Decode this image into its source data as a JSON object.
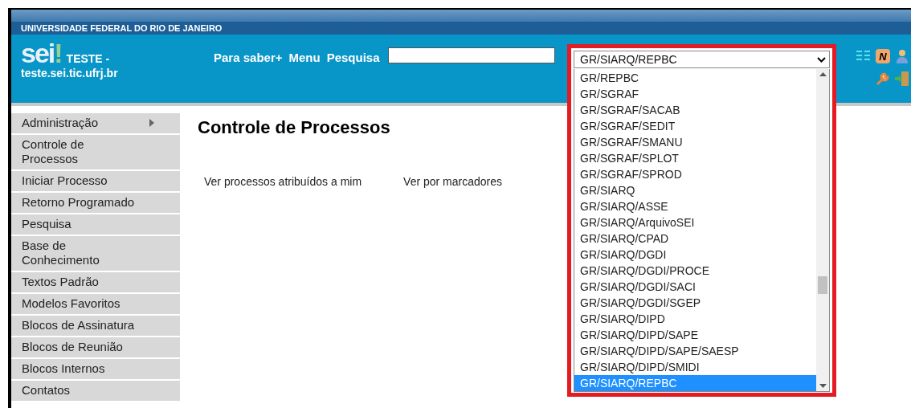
{
  "banner": {
    "title": "UNIVERSIDADE FEDERAL DO RIO DE JANEIRO"
  },
  "header": {
    "logo": "sei",
    "logo_mark": "!",
    "env": "TESTE -",
    "host": "teste.sei.tic.ufrj.br",
    "nav": [
      "Para saber+",
      "Menu",
      "Pesquisa"
    ],
    "badge": "N"
  },
  "unit_select": {
    "value": "GR/SIARQ/REPBC",
    "options": [
      {
        "label": "GR/REPBC",
        "selected": false
      },
      {
        "label": "GR/SGRAF",
        "selected": false
      },
      {
        "label": "GR/SGRAF/SACAB",
        "selected": false
      },
      {
        "label": "GR/SGRAF/SEDIT",
        "selected": false
      },
      {
        "label": "GR/SGRAF/SMANU",
        "selected": false
      },
      {
        "label": "GR/SGRAF/SPLOT",
        "selected": false
      },
      {
        "label": "GR/SGRAF/SPROD",
        "selected": false
      },
      {
        "label": "GR/SIARQ",
        "selected": false
      },
      {
        "label": "GR/SIARQ/ASSE",
        "selected": false
      },
      {
        "label": "GR/SIARQ/ArquivoSEI",
        "selected": false
      },
      {
        "label": "GR/SIARQ/CPAD",
        "selected": false
      },
      {
        "label": "GR/SIARQ/DGDI",
        "selected": false
      },
      {
        "label": "GR/SIARQ/DGDI/PROCE",
        "selected": false
      },
      {
        "label": "GR/SIARQ/DGDI/SACI",
        "selected": false
      },
      {
        "label": "GR/SIARQ/DGDI/SGEP",
        "selected": false
      },
      {
        "label": "GR/SIARQ/DIPD",
        "selected": false
      },
      {
        "label": "GR/SIARQ/DIPD/SAPE",
        "selected": false
      },
      {
        "label": "GR/SIARQ/DIPD/SAPE/SAESP",
        "selected": false
      },
      {
        "label": "GR/SIARQ/DIPD/SMIDI",
        "selected": false
      },
      {
        "label": "GR/SIARQ/REPBC",
        "selected": true
      }
    ]
  },
  "sidebar": {
    "items": [
      {
        "label": "Administração",
        "has_submenu": true
      },
      {
        "label": "Controle de Processos",
        "has_submenu": false
      },
      {
        "label": "Iniciar Processo",
        "has_submenu": false
      },
      {
        "label": "Retorno Programado",
        "has_submenu": false
      },
      {
        "label": "Pesquisa",
        "has_submenu": false
      },
      {
        "label": "Base de Conhecimento",
        "has_submenu": false
      },
      {
        "label": "Textos Padrão",
        "has_submenu": false
      },
      {
        "label": "Modelos Favoritos",
        "has_submenu": false
      },
      {
        "label": "Blocos de Assinatura",
        "has_submenu": false
      },
      {
        "label": "Blocos de Reunião",
        "has_submenu": false
      },
      {
        "label": "Blocos Internos",
        "has_submenu": false
      },
      {
        "label": "Contatos",
        "has_submenu": false
      }
    ]
  },
  "main": {
    "title": "Controle de Processos",
    "links": [
      "Ver processos atribuídos a mim",
      "Ver por marcadores"
    ]
  }
}
